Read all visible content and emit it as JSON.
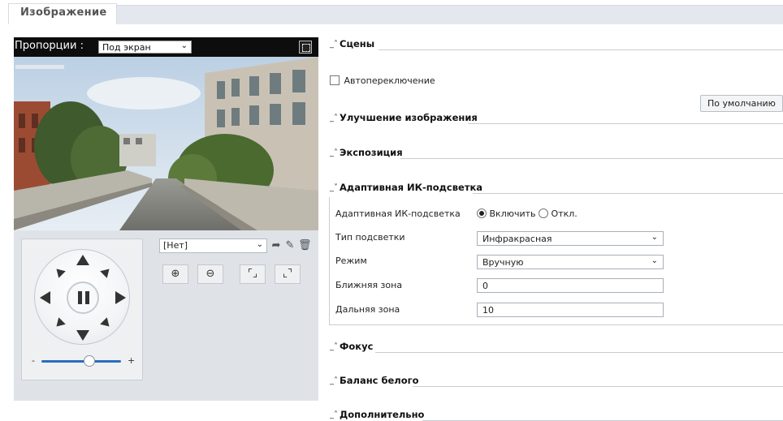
{
  "tab": {
    "label": "Изображение"
  },
  "preview": {
    "aspect_label": "Пропорции :",
    "aspect_value": "Под экран",
    "fullscreen_icon": "fullscreen-icon"
  },
  "ptz": {
    "preset_value": "[Нет]",
    "zoom_minus": "-",
    "zoom_plus": "+",
    "zoom_level": 0.6
  },
  "sections": {
    "scenes": "Сцены",
    "auto_switch": "Автопереключение",
    "default_button": "По умолчанию",
    "enhancement": "Улучшение изображения",
    "exposure": "Экспозиция",
    "adaptive_ir": "Адаптивная ИК-подсветка",
    "focus": "Фокус",
    "white_balance": "Баланс белого",
    "advanced": "Дополнительно"
  },
  "ir": {
    "adaptive_label": "Адаптивная ИК-подсветка",
    "enable_label": "Включить",
    "off_label": "Откл.",
    "enabled": true,
    "type_label": "Тип подсветки",
    "type_value": "Инфракрасная",
    "mode_label": "Режим",
    "mode_value": "Вручную",
    "near_label": "Ближняя зона",
    "near_value": "0",
    "far_label": "Дальняя зона",
    "far_value": "10"
  }
}
